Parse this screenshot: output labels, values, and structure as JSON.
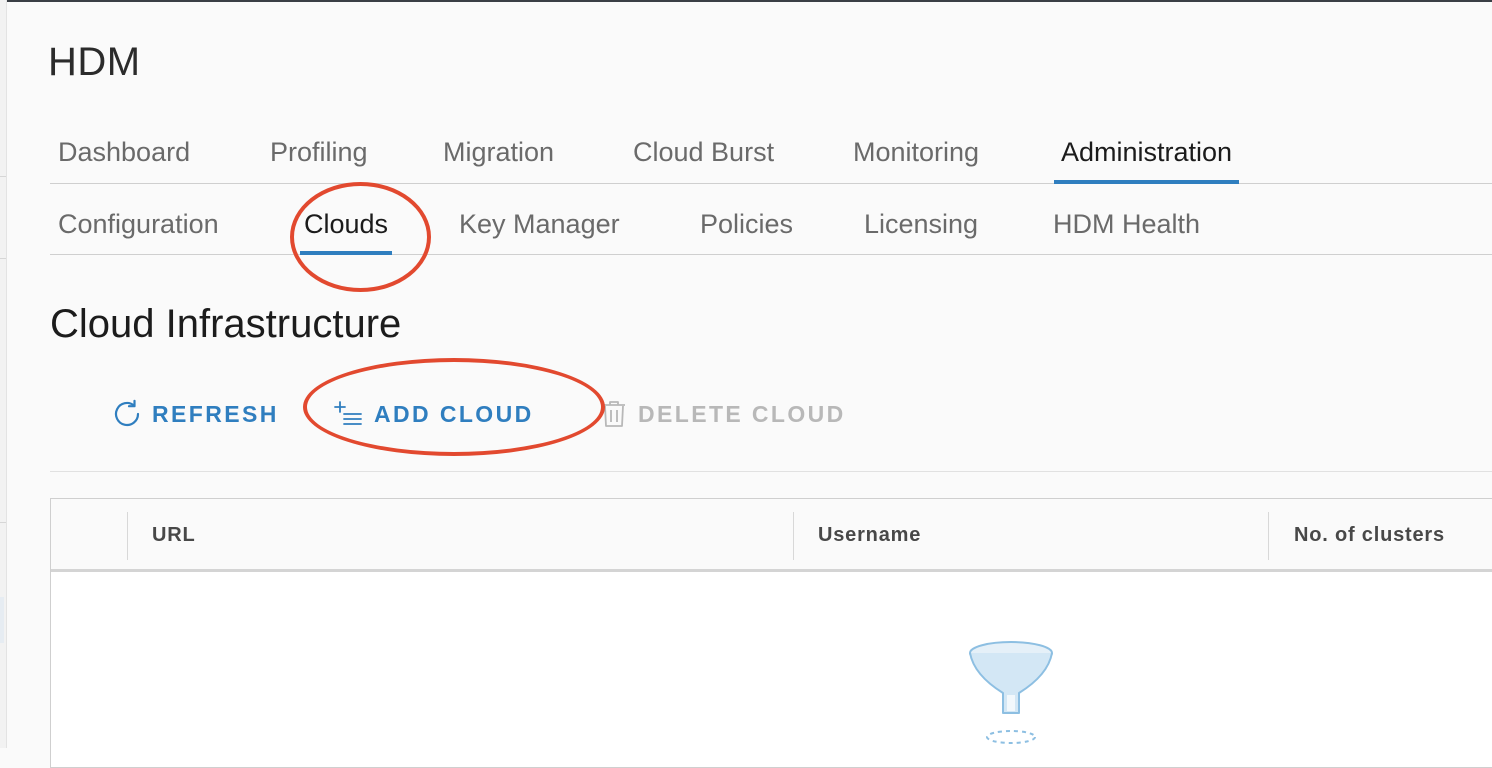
{
  "app": {
    "title": "HDM"
  },
  "nav_primary": {
    "items": [
      {
        "label": "Dashboard"
      },
      {
        "label": "Profiling"
      },
      {
        "label": "Migration"
      },
      {
        "label": "Cloud Burst"
      },
      {
        "label": "Monitoring"
      },
      {
        "label": "Administration",
        "active": true
      }
    ]
  },
  "nav_secondary": {
    "items": [
      {
        "label": "Configuration"
      },
      {
        "label": "Clouds",
        "active": true
      },
      {
        "label": "Key Manager"
      },
      {
        "label": "Policies"
      },
      {
        "label": "Licensing"
      },
      {
        "label": "HDM Health"
      }
    ]
  },
  "page": {
    "title": "Cloud Infrastructure"
  },
  "toolbar": {
    "refresh_label": "REFRESH",
    "add_cloud_label": "ADD CLOUD",
    "delete_cloud_label": "DELETE CLOUD",
    "refresh_icon": "refresh-icon",
    "add_icon": "add-list-icon",
    "delete_icon": "trash-icon"
  },
  "grid": {
    "columns": [
      "URL",
      "Username",
      "No. of clusters"
    ],
    "rows": [],
    "empty_icon": "empty-filter-funnel-icon"
  },
  "colors": {
    "accent": "#2f7ebf",
    "annotation": "#e2492f",
    "disabled": "#b8b8b8"
  }
}
